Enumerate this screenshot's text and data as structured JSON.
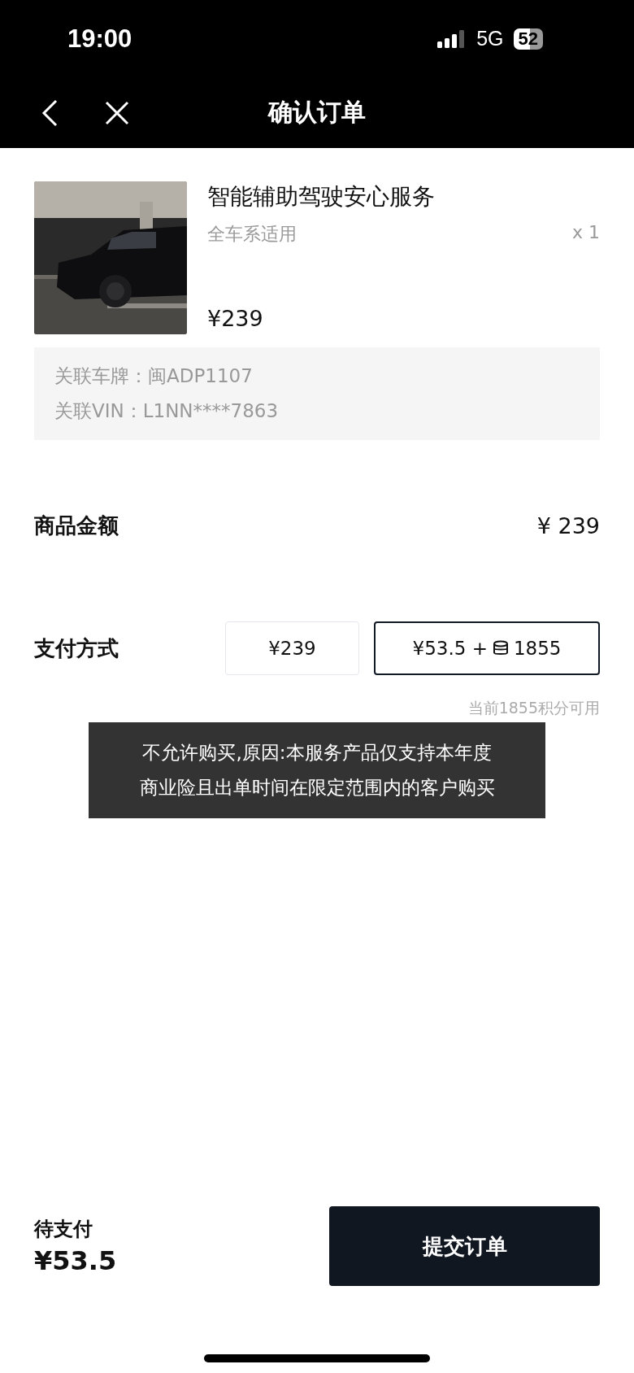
{
  "status_bar": {
    "time": "19:00",
    "network": "5G",
    "battery": "52"
  },
  "nav": {
    "title": "确认订单"
  },
  "product": {
    "name": "智能辅助驾驶安心服务",
    "subtitle": "全车系适用",
    "quantity": "x 1",
    "price": "¥239"
  },
  "vehicle_info": [
    {
      "label": "关联车牌：",
      "value": "闽ADP1107"
    },
    {
      "label": "关联VIN：",
      "value": "L1NN****7863"
    }
  ],
  "amount": {
    "label": "商品金额",
    "value": "¥ 239"
  },
  "payment": {
    "label": "支付方式",
    "options": [
      {
        "amount": "¥239",
        "selected": false
      },
      {
        "amount": "¥53.5 +",
        "points": "1855",
        "selected": true
      }
    ],
    "hint": "当前1855积分可用"
  },
  "toast": {
    "lines": [
      "不允许购买,原因:本服务产品仅支持本年度",
      "商业险且出单时间在限定范围内的客户购买"
    ]
  },
  "footer": {
    "label": "待支付",
    "total": "¥53.5",
    "submit": "提交订单"
  }
}
